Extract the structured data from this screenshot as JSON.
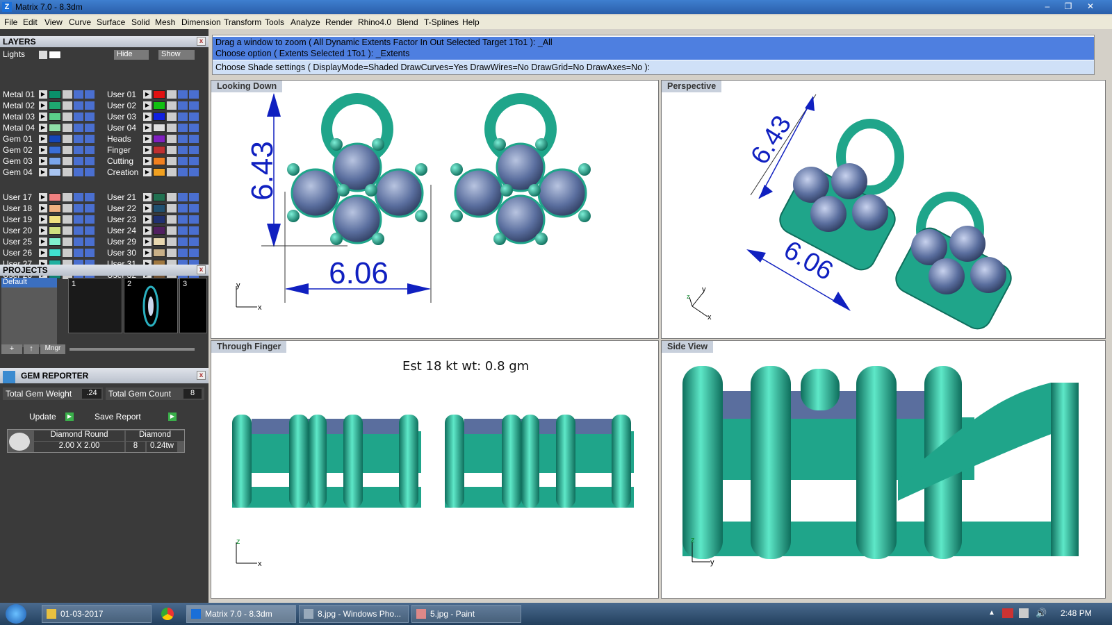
{
  "window": {
    "title": "Matrix 7.0 - 8.3dm"
  },
  "menu": [
    "File",
    "Edit",
    "View",
    "Curve",
    "Surface",
    "Solid",
    "Mesh",
    "Dimension",
    "Transform",
    "Tools",
    "Analyze",
    "Render",
    "Rhino4.0",
    "Blend",
    "T-Splines",
    "Help"
  ],
  "layers": {
    "title": "LAYERS",
    "lights_label": "Lights",
    "hide_label": "Hide",
    "show_label": "Show",
    "left": [
      {
        "name": "Metal 01",
        "color": "#0a8f6a"
      },
      {
        "name": "Metal 02",
        "color": "#1ea870"
      },
      {
        "name": "Metal 03",
        "color": "#5bd08a"
      },
      {
        "name": "Metal 04",
        "color": "#8fe0a8"
      },
      {
        "name": "Gem 01",
        "color": "#1446b8"
      },
      {
        "name": "Gem 02",
        "color": "#3a6fd8"
      },
      {
        "name": "Gem 03",
        "color": "#7aa6ec"
      },
      {
        "name": "Gem 04",
        "color": "#a8c4f0"
      },
      {
        "name": "User 17",
        "color": "#f08080"
      },
      {
        "name": "User 18",
        "color": "#f0b080"
      },
      {
        "name": "User 19",
        "color": "#f0e080"
      },
      {
        "name": "User 20",
        "color": "#d0e080"
      },
      {
        "name": "User 25",
        "color": "#80f0d0"
      },
      {
        "name": "User 26",
        "color": "#40e0d0"
      },
      {
        "name": "User 27",
        "color": "#20b0a0"
      },
      {
        "name": "User 28",
        "color": "#108070"
      }
    ],
    "right": [
      {
        "name": "User 01",
        "color": "#e01010"
      },
      {
        "name": "User 02",
        "color": "#10c010"
      },
      {
        "name": "User 03",
        "color": "#1020e0"
      },
      {
        "name": "User 04",
        "color": "#e0e0e0"
      },
      {
        "name": "Heads",
        "color": "#8020c0"
      },
      {
        "name": "Finger",
        "color": "#c03030"
      },
      {
        "name": "Cutting",
        "color": "#f08020"
      },
      {
        "name": "Creation",
        "color": "#f0a020"
      },
      {
        "name": "User 21",
        "color": "#207050"
      },
      {
        "name": "User 22",
        "color": "#205070"
      },
      {
        "name": "User 23",
        "color": "#203070"
      },
      {
        "name": "User 24",
        "color": "#502060"
      },
      {
        "name": "User 29",
        "color": "#e8d8b0"
      },
      {
        "name": "User 30",
        "color": "#c8b088"
      },
      {
        "name": "User 31",
        "color": "#a07840"
      },
      {
        "name": "User 32",
        "color": "#705030"
      }
    ]
  },
  "projects": {
    "title": "PROJECTS",
    "default_label": "Default",
    "slots": [
      "1",
      "2",
      "3"
    ],
    "mngr_label": "Mngr"
  },
  "gem_reporter": {
    "title": "GEM REPORTER",
    "total_weight_label": "Total Gem Weight",
    "total_weight_value": ".24",
    "total_count_label": "Total Gem Count",
    "total_count_value": "8",
    "update_label": "Update",
    "save_label": "Save Report",
    "row": {
      "shape": "Diamond Round",
      "size": "2.00 X 2.00",
      "type": "Diamond",
      "count": "8",
      "weight": "0.24tw"
    }
  },
  "command": {
    "line1": "Drag a window to zoom ( All  Dynamic  Extents  Factor  In  Out  Selected  Target  1To1 ): _All",
    "line2": "Choose option ( Extents  Selected  1To1 ): _Extents",
    "prompt": "Choose Shade settings ( DisplayMode=Shaded  DrawCurves=Yes  DrawWires=No  DrawGrid=No  DrawAxes=No ):"
  },
  "viewports": {
    "top_left": {
      "label": "Looking Down",
      "dim_vertical": "6.43",
      "dim_horizontal": "6.06",
      "axis_a": "y",
      "axis_b": "x"
    },
    "top_right": {
      "label": "Perspective",
      "dim_a": "6.43",
      "dim_b": "6.06",
      "axis_a": "y",
      "axis_b": "x",
      "axis_c": "z"
    },
    "bottom_left": {
      "label": "Through Finger",
      "note": "Est 18 kt wt: 0.8 gm",
      "axis_a": "z",
      "axis_b": "x"
    },
    "bottom_right": {
      "label": "Side View",
      "axis_a": "z",
      "axis_b": "y"
    }
  },
  "taskbar": {
    "items": [
      "01-03-2017",
      "Matrix 7.0 - 8.3dm",
      "8.jpg - Windows Pho...",
      "5.jpg - Paint"
    ],
    "clock": "2:48 PM"
  },
  "colors": {
    "metal": "#1fa58a",
    "gem": "#5a6e9e",
    "dim": "#1020c0"
  }
}
